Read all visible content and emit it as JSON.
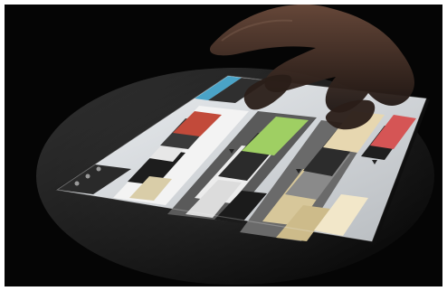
{
  "image": {
    "kind": "photograph",
    "subject": "tablet-with-catalog-app",
    "colors": {
      "background": "#070707",
      "screen_edge": "#d8dadd",
      "accent_header": "#4aa3c7",
      "skin": "#3a2a22"
    }
  },
  "tablet_screen": {
    "columns": [
      {
        "id": "left-column"
      },
      {
        "id": "middle-column"
      },
      {
        "id": "right-column"
      }
    ]
  }
}
